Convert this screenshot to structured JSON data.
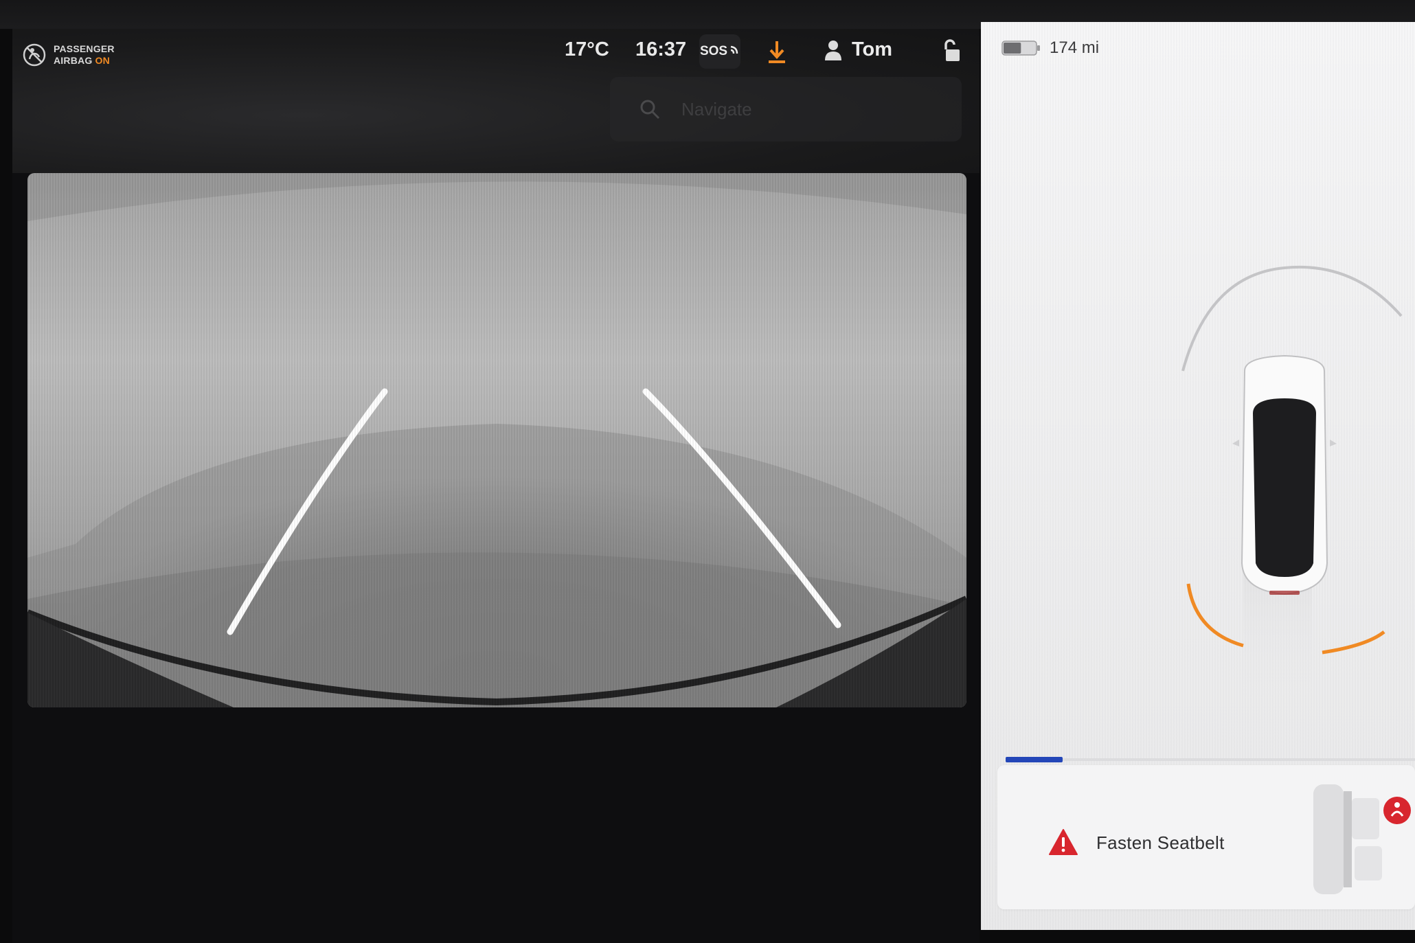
{
  "status_bar": {
    "airbag_line1": "PASSENGER",
    "airbag_line2": "AIRBAG",
    "airbag_state": "ON",
    "temperature": "17°C",
    "time": "16:37",
    "sos_label": "SOS",
    "profile_name": "Tom"
  },
  "search": {
    "placeholder": "Navigate"
  },
  "vehicle": {
    "range": "174 mi",
    "battery_fraction": 0.55
  },
  "alert": {
    "message": "Fasten Seatbelt",
    "progress_fraction": 0.14
  },
  "colors": {
    "accent_orange": "#f08a24",
    "alert_red": "#d8262e",
    "progress_blue": "#2346b8"
  },
  "icons": [
    "airbag-off-icon",
    "sos-call-icon",
    "download-icon",
    "profile-icon",
    "unlock-icon",
    "search-icon",
    "battery-icon",
    "warning-icon"
  ]
}
